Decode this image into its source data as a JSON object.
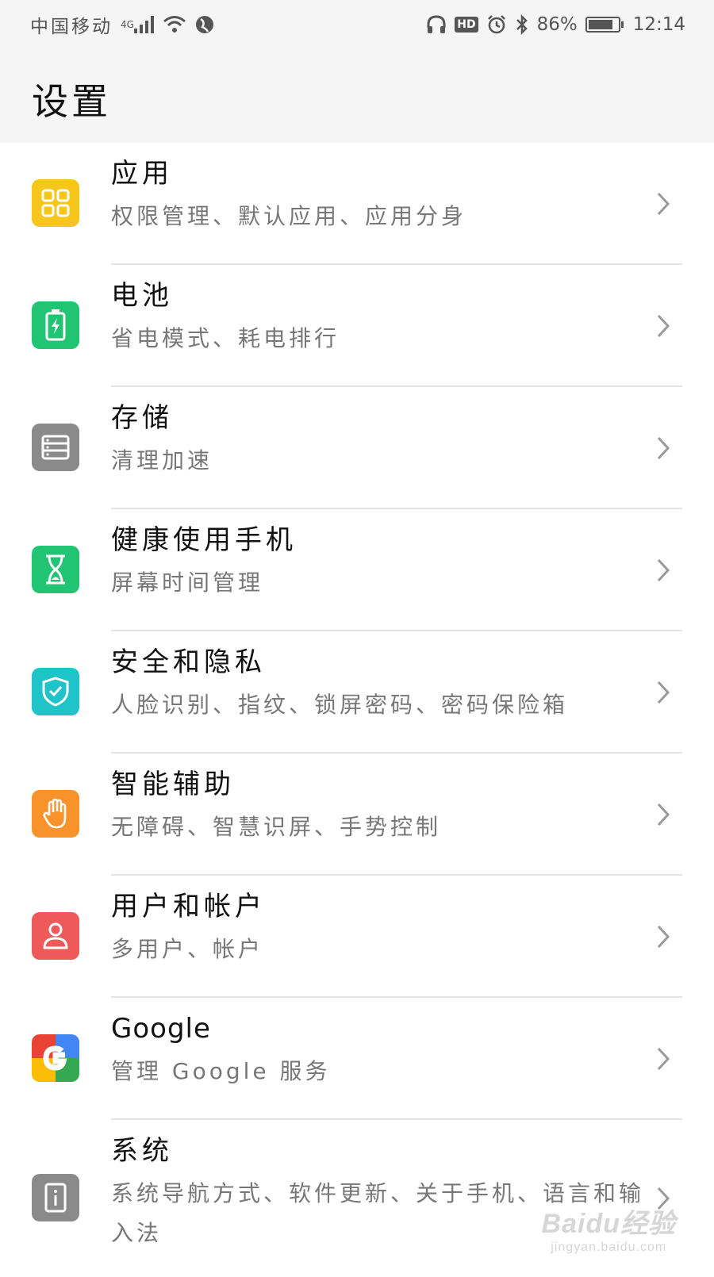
{
  "status_bar": {
    "carrier": "中国移动",
    "network": "4G",
    "battery_percent": "86%",
    "battery_level": 0.86,
    "time": "12:14"
  },
  "header": {
    "title": "设置"
  },
  "settings": [
    {
      "name": "应用",
      "desc": "权限管理、默认应用、应用分身",
      "icon": "apps-grid-icon",
      "color": "#F7C61A"
    },
    {
      "name": "电池",
      "desc": "省电模式、耗电排行",
      "icon": "battery-charging-icon",
      "color": "#20C472"
    },
    {
      "name": "存储",
      "desc": "清理加速",
      "icon": "storage-icon",
      "color": "#8A8A8A"
    },
    {
      "name": "健康使用手机",
      "desc": "屏幕时间管理",
      "icon": "hourglass-icon",
      "color": "#20C472"
    },
    {
      "name": "安全和隐私",
      "desc": "人脸识别、指纹、锁屏密码、密码保险箱",
      "icon": "shield-check-icon",
      "color": "#1FC4C8"
    },
    {
      "name": "智能辅助",
      "desc": "无障碍、智慧识屏、手势控制",
      "icon": "hand-icon",
      "color": "#F7932A"
    },
    {
      "name": "用户和帐户",
      "desc": "多用户、帐户",
      "icon": "user-icon",
      "color": "#EE5A5A"
    },
    {
      "name": "Google",
      "desc": "管理 Google 服务",
      "icon": "google-g-icon",
      "color": "#FFFFFF"
    },
    {
      "name": "系统",
      "desc": "系统导航方式、软件更新、关于手机、语言和输入法",
      "icon": "system-info-icon",
      "color": "#8A8A8A"
    }
  ],
  "watermark": {
    "logo": "Baidu经验",
    "url": "jingyan.baidu.com"
  }
}
